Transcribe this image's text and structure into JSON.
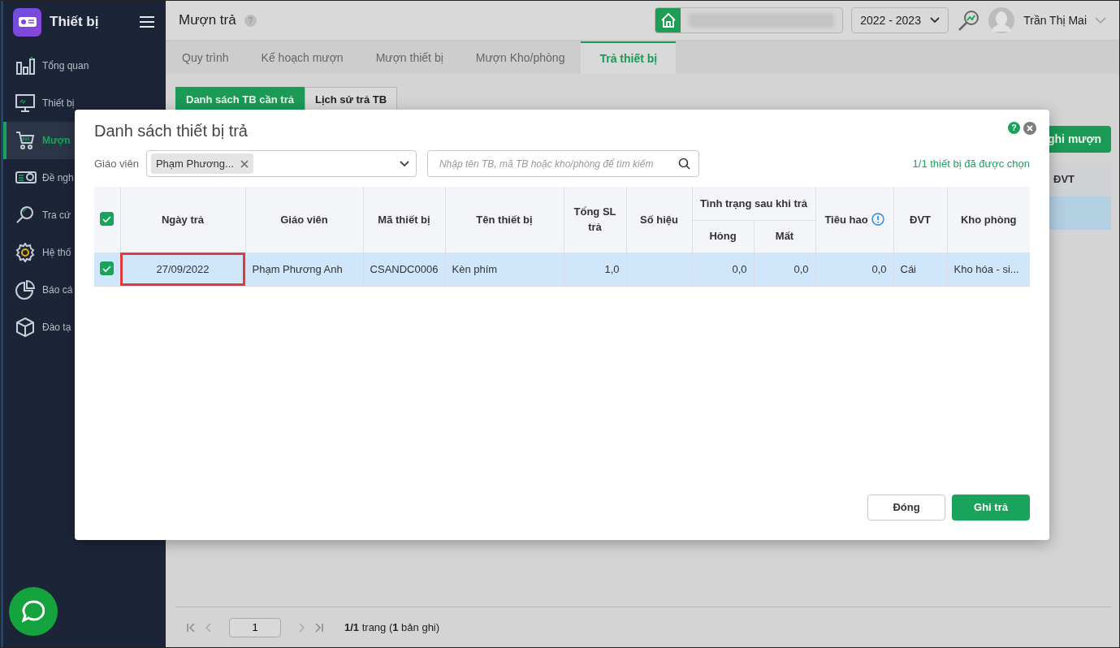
{
  "app": {
    "title": "Thiết bị"
  },
  "sidebar": {
    "items": [
      {
        "label": "Tổng quan",
        "selected": false
      },
      {
        "label": "Thiết bị",
        "selected": false
      },
      {
        "label": "Mượn",
        "selected": true
      },
      {
        "label": "Đề ngh",
        "selected": false
      },
      {
        "label": "Tra cứ",
        "selected": false
      },
      {
        "label": "Hệ thố",
        "selected": false
      },
      {
        "label": "Báo cá",
        "selected": false
      },
      {
        "label": "Đào tạ",
        "selected": false
      }
    ]
  },
  "header": {
    "title": "Mượn trả",
    "help_glyph": "?",
    "school_year": "2022 - 2023",
    "user": "Trần Thị Mai"
  },
  "tabs": [
    {
      "label": "Quy trình",
      "selected": false
    },
    {
      "label": "Kế hoạch mượn",
      "selected": false
    },
    {
      "label": "Mượn thiết bị",
      "selected": false
    },
    {
      "label": "Mượn Kho/phòng",
      "selected": false
    },
    {
      "label": "Trả thiết bị",
      "selected": true
    }
  ],
  "subtabs": [
    {
      "label": "Danh sách TB cần trả",
      "selected": true
    },
    {
      "label": "Lịch sử trả TB",
      "selected": false
    }
  ],
  "background_action": "ghi mượn",
  "background_table": {
    "visible_column": "ĐVT",
    "row_selected": true
  },
  "pagination": {
    "page": "1",
    "summary": "**1/1** trang (**1** bản ghi)"
  },
  "modal": {
    "title": "Danh sách thiết bị trả",
    "help_glyph": "?",
    "filter_label": "Giáo viên",
    "teacher_tag": "Phạm Phương...",
    "search_placeholder": "Nhập tên TB, mã TB hoặc kho/phòng để tìm kiếm",
    "selection_count": "1/1 thiết bị đã được chọn",
    "table": {
      "columns": [
        {
          "kind": "checkbox",
          "checked": true
        },
        {
          "label": "Ngày trả",
          "kind": "center"
        },
        {
          "label": "Giáo viên",
          "kind": "text"
        },
        {
          "label": "Mã thiết bị",
          "kind": "center"
        },
        {
          "label": "Tên thiết bị",
          "kind": "text"
        },
        {
          "label": "Tổng SL trả",
          "kind": "number"
        },
        {
          "label": "Số hiệu",
          "kind": "text"
        },
        {
          "label": "Tình trạng sau khi trả",
          "kind": "group",
          "colspan": 2,
          "children": [
            {
              "label": "Hỏng",
              "kind": "number"
            },
            {
              "label": "Mất",
              "kind": "number"
            }
          ]
        },
        {
          "label": "Tiêu hao",
          "kind": "number",
          "info": true
        },
        {
          "label": "ĐVT",
          "kind": "text"
        },
        {
          "label": "Kho phòng",
          "kind": "text"
        }
      ],
      "rows": [
        {
          "checked": true,
          "selected": true,
          "date_outlined": true,
          "cells": [
            "",
            "27/09/2022",
            "Phạm Phương Anh",
            "CSANDC0006",
            "Kèn phím",
            "1,0",
            "",
            "0,0",
            "0,0",
            "0,0",
            "Cái",
            "Kho hóa - si..."
          ]
        }
      ]
    },
    "buttons": [
      {
        "label": "Đóng",
        "kind": "secondary"
      },
      {
        "label": "Ghi trả",
        "kind": "primary"
      }
    ]
  }
}
